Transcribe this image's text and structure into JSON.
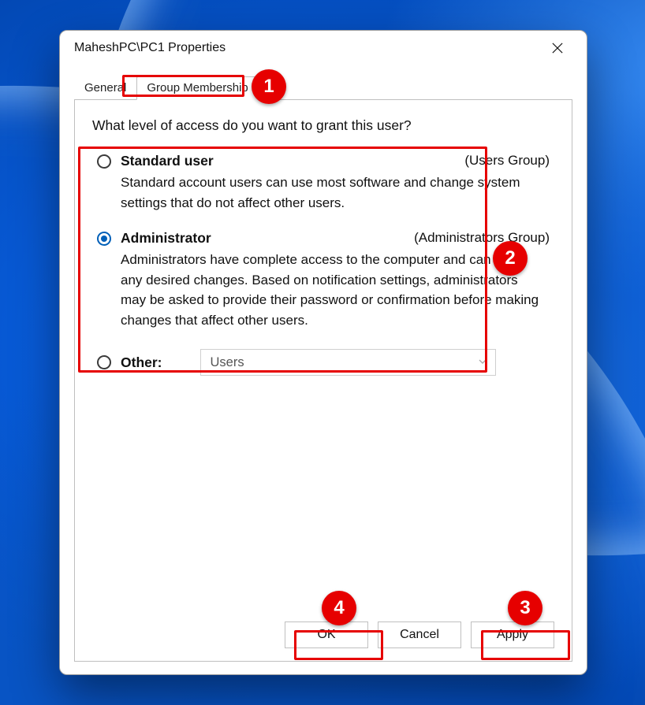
{
  "window_title": "MaheshPC\\PC1 Properties",
  "tabs": {
    "general": "General",
    "group_membership": "Group Membership"
  },
  "prompt": "What level of access do you want to grant this user?",
  "options": {
    "standard": {
      "label": "Standard user",
      "group": "(Users Group)",
      "desc": "Standard account users can use most software and change system settings that do not affect other users."
    },
    "administrator": {
      "label": "Administrator",
      "group": "(Administrators Group)",
      "desc": "Administrators have complete access to the computer and can make any desired changes. Based on notification settings, administrators may be asked to provide their password or confirmation before making changes that affect other users."
    },
    "other": {
      "label": "Other:",
      "selected_value": "Users"
    }
  },
  "buttons": {
    "ok": "OK",
    "cancel": "Cancel",
    "apply": "Apply"
  },
  "annotations": {
    "b1": "1",
    "b2": "2",
    "b3": "3",
    "b4": "4"
  }
}
